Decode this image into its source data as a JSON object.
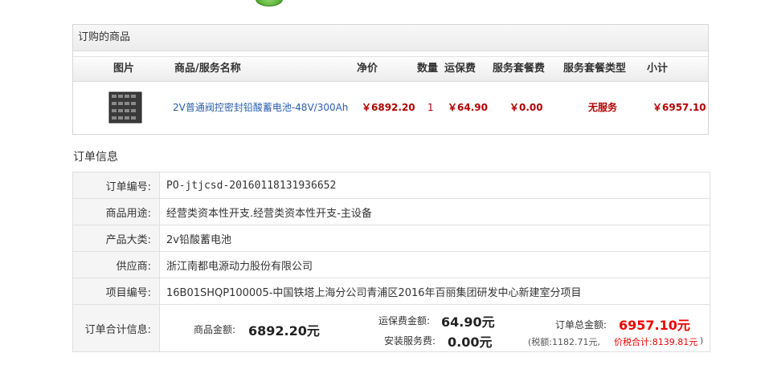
{
  "goods": {
    "title": "订购的商品",
    "headers": [
      "图片",
      "商品/服务名称",
      "净价",
      "数量",
      "运保费",
      "服务套餐费",
      "服务套餐类型",
      "小计"
    ],
    "item": {
      "name": "2V普通阀控密封铅酸蓄电池-48V/300Ah",
      "price": "￥6892.20",
      "qty": "1",
      "shipping": "￥64.90",
      "service_fee": "￥0.00",
      "service_type": "无服务",
      "subtotal": "￥6957.10"
    }
  },
  "order": {
    "title": "订单信息",
    "rows": [
      {
        "label": "订单编号:",
        "value": "PO-jtjcsd-20160118131936652"
      },
      {
        "label": "商品用途:",
        "value": "经营类资本性开支.经营类资本性开支-主设备"
      },
      {
        "label": "产品大类:",
        "value": "2v铅酸蓄电池"
      },
      {
        "label": "供应商:",
        "value": "浙江南都电源动力股份有限公司"
      },
      {
        "label": "项目编号:",
        "value": "16B01SHQP100005-中国铁塔上海分公司青浦区2016年百丽集团研发中心新建室分项目"
      }
    ],
    "total": {
      "label": "订单合计信息:",
      "goods_label": "商品金额:",
      "goods_value": "6892.20元",
      "ship_label": "运保费金额:",
      "ship_value": "64.90元",
      "install_label": "安装服务费:",
      "install_value": "0.00元",
      "order_label": "订单总金额:",
      "order_value": "6957.10元",
      "tax_note": "(税额:1182.71元,",
      "tax_total": "价税合计:8139.81元",
      "tax_close": ")"
    }
  },
  "colors": {
    "accent_red": "#b30000",
    "link_blue": "#2a5db0"
  }
}
